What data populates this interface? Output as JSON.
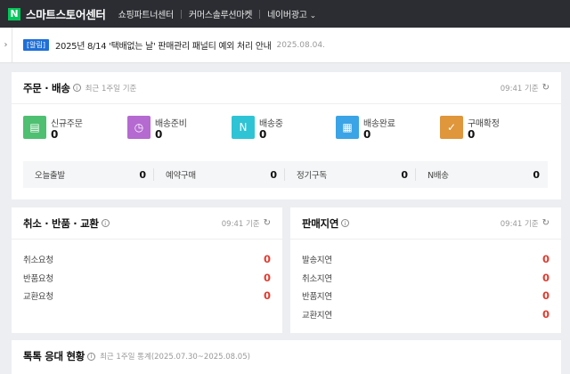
{
  "topbar": {
    "logo_letter": "N",
    "brand": "스마트스토어센터",
    "links": [
      "쇼핑파트너센터",
      "커머스솔루션마켓",
      "네이버광고"
    ]
  },
  "notice": {
    "tag": "[알림]",
    "text": "2025년 8/14 '택배없는 날' 판매관리 패널티 예외 처리 안내",
    "date": "2025.08.04."
  },
  "orders": {
    "title": "주문 · 배송",
    "basis": "최근 1주일 기준",
    "time": "09:41 기준",
    "stats": [
      {
        "label": "신규주문",
        "value": "0",
        "color": "#4fbf72",
        "icon": "document-icon"
      },
      {
        "label": "배송준비",
        "value": "0",
        "color": "#b56ad1",
        "icon": "clock-icon"
      },
      {
        "label": "배송중",
        "value": "0",
        "color": "#2ec4d6",
        "icon": "truck-icon"
      },
      {
        "label": "배송완료",
        "value": "0",
        "color": "#3aa4e6",
        "icon": "gift-icon"
      },
      {
        "label": "구매확정",
        "value": "0",
        "color": "#e0963a",
        "icon": "check-icon"
      }
    ],
    "sub": [
      {
        "label": "오늘출발",
        "value": "0"
      },
      {
        "label": "예약구매",
        "value": "0"
      },
      {
        "label": "정기구독",
        "value": "0"
      },
      {
        "label": "N배송",
        "value": "0"
      }
    ]
  },
  "claims": {
    "title": "취소 · 반품 · 교환",
    "time": "09:41 기준",
    "items": [
      {
        "label": "취소요청",
        "value": "0"
      },
      {
        "label": "반품요청",
        "value": "0"
      },
      {
        "label": "교환요청",
        "value": "0"
      }
    ]
  },
  "delays": {
    "title": "판매지연",
    "time": "09:41 기준",
    "items": [
      {
        "label": "발송지연",
        "value": "0"
      },
      {
        "label": "취소지연",
        "value": "0"
      },
      {
        "label": "반품지연",
        "value": "0"
      },
      {
        "label": "교환지연",
        "value": "0"
      }
    ]
  },
  "talktalk": {
    "title": "톡톡 응대 현황",
    "basis": "최근 1주일 통계(2025.07.30~2025.08.05)"
  },
  "colors": {
    "accent": "#03c75a",
    "alert": "#e23b2f",
    "notice_tag": "#1f6fd8"
  }
}
